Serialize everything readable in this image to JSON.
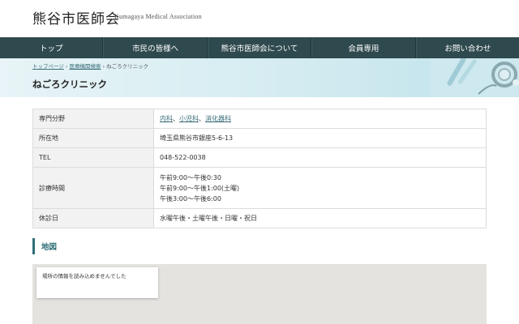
{
  "header": {
    "logo": "熊谷市医師会",
    "logo_sub": "Kumagaya Medical Association"
  },
  "nav": {
    "items": [
      {
        "label": "トップ"
      },
      {
        "label": "市民の皆様へ"
      },
      {
        "label": "熊谷市医師会について"
      },
      {
        "label": "会員専用"
      },
      {
        "label": "お問い合わせ"
      }
    ]
  },
  "breadcrumb": {
    "items": [
      "トップページ",
      "医療機関検索",
      "ねごろクリニック"
    ],
    "separator": "›"
  },
  "page": {
    "title": "ねごろクリニック"
  },
  "info": {
    "specialty_label": "専門分野",
    "specialties": [
      "内科",
      "小児科",
      "消化器科"
    ],
    "comma": "、",
    "address_label": "所在地",
    "address": "埼玉県熊谷市銀座5-6-13",
    "tel_label": "TEL",
    "tel": "048-522-0038",
    "hours_label": "診療時間",
    "hours": [
      "午前9:00〜午後0:30",
      "午前9:00〜午後1:00(土曜)",
      "午後3:00〜午後6:00"
    ],
    "closed_label": "休診日",
    "closed": "水曜午後・土曜午後・日曜・祝日"
  },
  "map": {
    "heading": "地図",
    "error_text": "場所の情報を読み込めませんでした"
  },
  "colors": {
    "nav_bg": "#2f4a4f",
    "accent": "#2f6f78",
    "link": "#3a6e7a"
  }
}
